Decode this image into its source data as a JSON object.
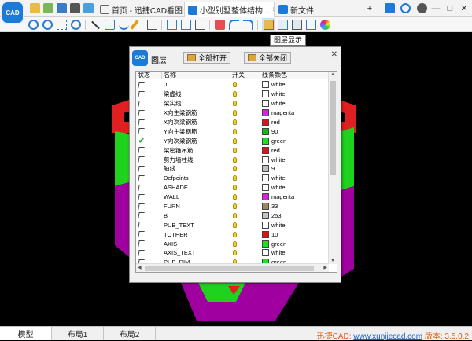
{
  "app": {
    "logo_text": "CAD"
  },
  "tabs": [
    {
      "label": "首页 - 迅捷CAD看图",
      "active": false
    },
    {
      "label": "小型别墅整体结构...",
      "active": true,
      "close": "×"
    },
    {
      "label": "新文件",
      "active": false
    }
  ],
  "window_controls": {
    "add": "+",
    "minimize": "—",
    "maximize": "□",
    "close": "✕"
  },
  "tooltip": "图层显示",
  "dialog": {
    "logo_text": "CAD",
    "title": "图层",
    "open_all": "全部打开",
    "close_all": "全部关闭",
    "close": "✕",
    "columns": [
      "状态",
      "名称",
      "开关",
      "线条颜色"
    ],
    "rows": [
      {
        "state": "icon",
        "name": "0",
        "color_name": "white",
        "color": "#ffffff"
      },
      {
        "state": "icon",
        "name": "梁虚线",
        "color_name": "white",
        "color": "#ffffff"
      },
      {
        "state": "icon",
        "name": "梁实线",
        "color_name": "white",
        "color": "#ffffff"
      },
      {
        "state": "icon",
        "name": "X向主梁钢筋",
        "color_name": "magenta",
        "color": "#e01ee0"
      },
      {
        "state": "icon",
        "name": "X向次梁钢筋",
        "color_name": "red",
        "color": "#e01313"
      },
      {
        "state": "icon",
        "name": "Y向主梁钢筋",
        "color_name": "90",
        "color": "#17b51a"
      },
      {
        "state": "check",
        "name": "Y向次梁钢筋",
        "color_name": "green",
        "color": "#1ee01e"
      },
      {
        "state": "icon",
        "name": "梁密箍吊筋",
        "color_name": "red",
        "color": "#e01313"
      },
      {
        "state": "icon",
        "name": "剪力墙柱线",
        "color_name": "white",
        "color": "#ffffff"
      },
      {
        "state": "icon",
        "name": "轴线",
        "color_name": "9",
        "color": "#c0c0c0"
      },
      {
        "state": "icon",
        "name": "Defpoints",
        "color_name": "white",
        "color": "#ffffff"
      },
      {
        "state": "icon",
        "name": "ASHADE",
        "color_name": "white",
        "color": "#ffffff"
      },
      {
        "state": "icon",
        "name": "WALL",
        "color_name": "magenta",
        "color": "#e01ee0"
      },
      {
        "state": "icon",
        "name": "FURN",
        "color_name": "33",
        "color": "#a08560"
      },
      {
        "state": "icon",
        "name": "B",
        "color_name": "253",
        "color": "#c4c4c4"
      },
      {
        "state": "icon",
        "name": "PUB_TEXT",
        "color_name": "white",
        "color": "#ffffff"
      },
      {
        "state": "icon",
        "name": "TOTHER",
        "color_name": "10",
        "color": "#e01313"
      },
      {
        "state": "icon",
        "name": "AXIS",
        "color_name": "green",
        "color": "#1ee01e"
      },
      {
        "state": "icon",
        "name": "AXIS_TEXT",
        "color_name": "white",
        "color": "#ffffff"
      },
      {
        "state": "icon",
        "name": "PUB_DIM",
        "color_name": "green",
        "color": "#1ee01e"
      }
    ]
  },
  "bottom_tabs": [
    "模型",
    "布局1",
    "布局2"
  ],
  "version": {
    "prefix": "迅捷CAD: ",
    "url": "www.xunjiecad.com",
    "suffix": " 版本: 3.5.0.2"
  }
}
